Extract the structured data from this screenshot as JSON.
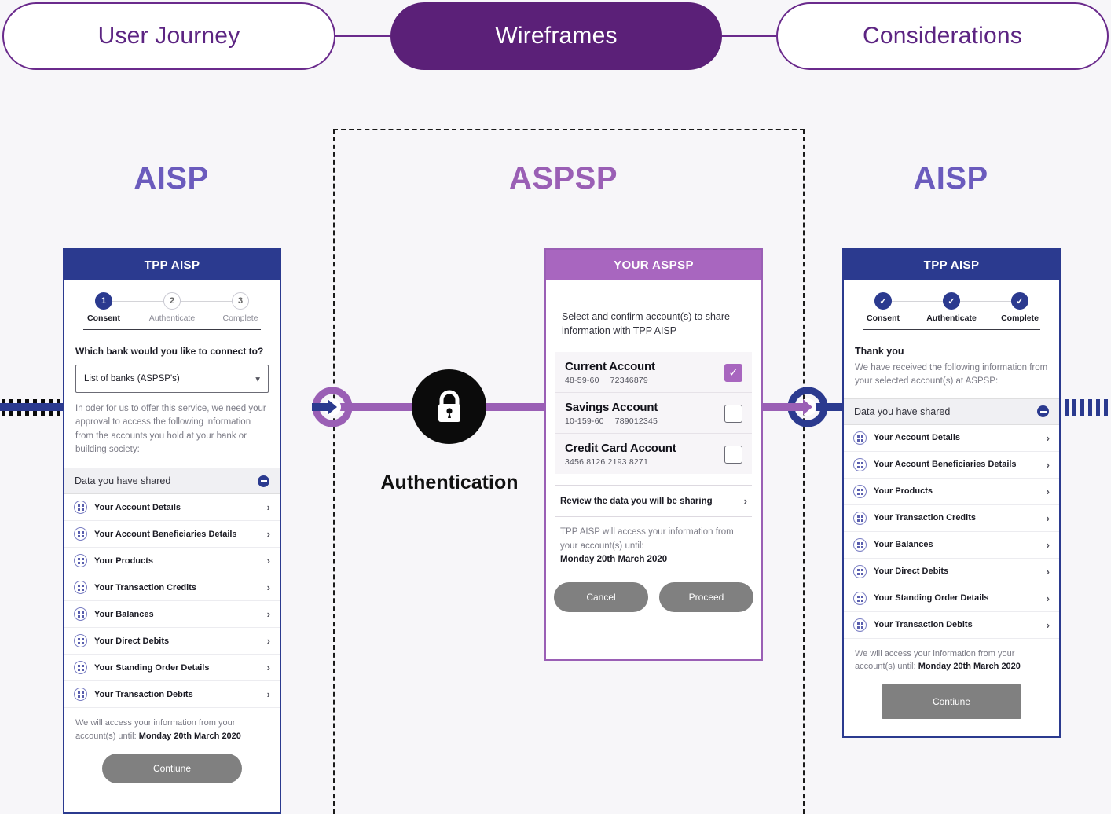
{
  "tabs": [
    {
      "label": "User Journey",
      "active": false
    },
    {
      "label": "Wireframes",
      "active": true
    },
    {
      "label": "Considerations",
      "active": false
    }
  ],
  "columns": {
    "left_heading": "AISP",
    "middle_heading": "ASPSP",
    "right_heading": "AISP"
  },
  "flow": {
    "auth_label": "Authentication",
    "lock_icon": "lock-icon",
    "arrow_left_icon": "arrow-right-ring-icon",
    "arrow_right_icon": "arrow-right-ring-icon",
    "navy_color": "#2b3a8f",
    "purple_color": "#9a5fb5"
  },
  "phone_left": {
    "header": "TPP AISP",
    "steps": [
      {
        "badge": "1",
        "label": "Consent",
        "state": "active"
      },
      {
        "badge": "2",
        "label": "Authenticate",
        "state": "inactive"
      },
      {
        "badge": "3",
        "label": "Complete",
        "state": "inactive"
      }
    ],
    "question": "Which bank would you like to connect to?",
    "select_value": "List of banks (ASPSP's)",
    "chevron_icon": "chevron-down-icon",
    "intro_note": "In oder for us to offer this service, we need your approval to access the following information from the accounts you hold at your bank or building society:",
    "accordion_title": "Data you have shared",
    "accordion_toggle_icon": "minus-circle-icon",
    "items": [
      "Your Account Details",
      "Your Account Beneficiaries Details",
      "Your Products",
      "Your Transaction Credits",
      "Your Balances",
      "Your Direct Debits",
      "Your Standing Order Details",
      "Your Transaction Debits"
    ],
    "footnote_prefix": "We will access your information from your account(s) until: ",
    "footnote_date": "Monday 20th March 2020",
    "button": "Contiune"
  },
  "phone_mid": {
    "header": "YOUR ASPSP",
    "intro": "Select and confirm account(s) to share information with TPP AISP",
    "accounts": [
      {
        "name": "Current Account",
        "sort_code": "48-59-60",
        "number": "72346879",
        "checked": true
      },
      {
        "name": "Savings Account",
        "sort_code": "10-159-60",
        "number": "789012345",
        "checked": false
      },
      {
        "name": "Credit Card Account",
        "sort_code": "3456 8126 2193 8271",
        "number": "",
        "checked": false
      }
    ],
    "review_label": "Review the data you will be sharing",
    "review_chevron_icon": "chevron-right-icon",
    "note_prefix": "TPP AISP will access your information from your account(s) until:",
    "note_date": "Monday 20th March 2020",
    "cancel_button": "Cancel",
    "proceed_button": "Proceed"
  },
  "phone_right": {
    "header": "TPP AISP",
    "steps": [
      {
        "badge": "✓",
        "label": "Consent",
        "state": "done"
      },
      {
        "badge": "✓",
        "label": "Authenticate",
        "state": "done"
      },
      {
        "badge": "✓",
        "label": "Complete",
        "state": "done"
      }
    ],
    "thanks_title": "Thank you",
    "thanks_note": "We have received the following information from your selected account(s) at ASPSP:",
    "accordion_title": "Data you have shared",
    "accordion_toggle_icon": "minus-circle-icon",
    "items": [
      "Your Account Details",
      "Your Account Beneficiaries Details",
      "Your Products",
      "Your Transaction Credits",
      "Your Balances",
      "Your Direct Debits",
      "Your Standing Order Details",
      "Your Transaction Debits"
    ],
    "footnote_prefix": "We will access your information from your account(s) until: ",
    "footnote_date": "Monday 20th March 2020",
    "button": "Contiune"
  }
}
